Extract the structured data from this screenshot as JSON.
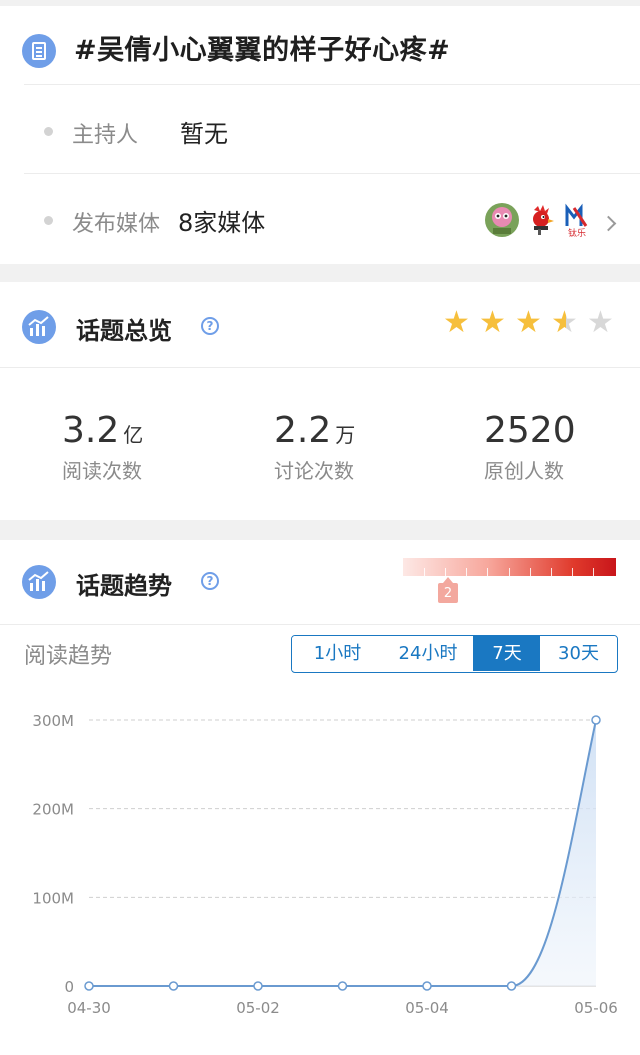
{
  "topic": {
    "title": "#吴倩小心翼翼的样子好心疼#",
    "host_label": "主持人",
    "host_value": "暂无",
    "media_label": "发布媒体",
    "media_value": "8家媒体",
    "media_badge_text": "钛乐"
  },
  "overview": {
    "title": "话题总览",
    "help": "?",
    "rating_stars": 3.5,
    "rating_max": 5,
    "stats": [
      {
        "value": "3.2",
        "unit": "亿",
        "label": "阅读次数"
      },
      {
        "value": "2.2",
        "unit": "万",
        "label": "讨论次数"
      },
      {
        "value": "2520",
        "unit": "",
        "label": "原创人数"
      }
    ]
  },
  "trend": {
    "title": "话题趋势",
    "help": "?",
    "heat_level": "2",
    "subtitle": "阅读趋势",
    "range_tabs": [
      {
        "label": "1小时",
        "active": false
      },
      {
        "label": "24小时",
        "active": false
      },
      {
        "label": "7天",
        "active": true
      },
      {
        "label": "30天",
        "active": false
      }
    ]
  },
  "colors": {
    "accent_blue": "#1a78c2",
    "icon_blue": "#6f9ee8",
    "star_gold": "#f6bf3c",
    "heat_red": "#c8151a",
    "line_blue": "#6a9ad0"
  },
  "chart_data": {
    "type": "area",
    "title": "",
    "xlabel": "",
    "ylabel": "",
    "x": [
      "04-30",
      "05-01",
      "05-02",
      "05-03",
      "05-04",
      "05-05",
      "05-06"
    ],
    "x_tick_labels": [
      "04-30",
      "05-02",
      "05-04",
      "05-06"
    ],
    "y_tick_labels": [
      "0",
      "100M",
      "200M",
      "300M"
    ],
    "ylim": [
      0,
      300000000
    ],
    "series": [
      {
        "values": [
          0,
          0,
          0,
          0,
          0,
          0,
          300000000
        ]
      }
    ],
    "grid": true,
    "legend": "none"
  }
}
